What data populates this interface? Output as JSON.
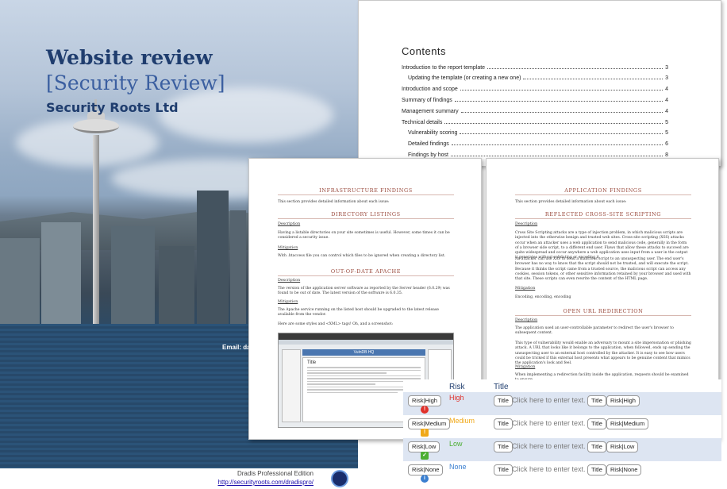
{
  "cover": {
    "title": "Website review",
    "subtitle": "[Security Review]",
    "company": "Security Roots Ltd",
    "email": "Email: dan",
    "edition": "Dradis Professional Edition",
    "url": "http://securityroots.com/dradispro/"
  },
  "contents": {
    "heading": "Contents",
    "entries": [
      {
        "label": "Introduction to the report template",
        "page": "3"
      },
      {
        "label": "Updating the template (or creating a new one)",
        "page": "3"
      },
      {
        "label": "Introduction and scope",
        "page": "4"
      },
      {
        "label": "Summary of findings",
        "page": "4"
      },
      {
        "label": "Management summary",
        "page": "4"
      },
      {
        "label": "Technical details",
        "page": "5"
      },
      {
        "label": "Vulnerability scoring",
        "page": "5"
      },
      {
        "label": "Detailed findings",
        "page": "6"
      },
      {
        "label": "Findings by host",
        "page": "8"
      }
    ]
  },
  "infra": {
    "heading": "INFRASTRUCTURE FINDINGS",
    "intro": "This section provides detailed information about each issue:",
    "f1_title": "DIRECTORY LISTINGS",
    "desc_label": "Description",
    "f1_desc": "Having a listable directories on your site sometimes is useful. However, some times it can be considered a security issue.",
    "mit_label": "Mitigation",
    "f1_mit": "With .htaccess file you can control which files to be ignored when creating a directory list.",
    "f2_title": "OUT-OF-DATE APACHE",
    "f2_desc": "The version of the application server software as reported by the Server header (6.0.29) was found to be out of date. The latest version of the software is 6.0.35.",
    "f2_mit": "The Apache service running on the listed host should be upgraded to the latest release available from the vendor.",
    "f2_note": "Here are some styles and <XML> tags! Oh, and a screenshot:",
    "shot_app": "VulnDB HQ",
    "shot_title": "Title"
  },
  "app": {
    "heading": "APPLICATION FINDINGS",
    "intro": "This section provides detailed information about each issue:",
    "f1_title": "REFLECTED CROSS-SITE SCRIPTING",
    "desc_label": "Description",
    "f1_desc": "Cross Site Scripting attacks are a type of injection problem, in which malicious scripts are injected into the otherwise benign and trusted web sites. Cross-site scripting (XSS) attacks occur when an attacker uses a web application to send malicious code, generally in the form of a browser side script, to a different end user. Flaws that allow these attacks to succeed are quite widespread and occur anywhere a web application uses input from a user in the output it generates without validating or encoding it.",
    "f1_desc2": "An attacker can use XSS to send a malicious script to an unsuspecting user. The end user's browser has no way to know that the script should not be trusted, and will execute the script. Because it thinks the script came from a trusted source, the malicious script can access any cookies, session tokens, or other sensitive information retained by your browser and used with that site. These scripts can even rewrite the content of the HTML page.",
    "mit_label": "Mitigation",
    "f1_mit": "Encoding, encoding, encoding",
    "f2_title": "OPEN URL REDIRECTION",
    "f2_desc": "The application used an user-controllable parameter to redirect the user's browser to subsequent content.",
    "f2_desc2": "This type of vulnerability would enable an adversary to mount a site impersonation or phishing attack. A URL that looks like it belongs to the application, when followed, ends up sending the unsuspecting user to an external host controlled by the attacker. It is easy to see how users could be tricked if this external host presents what appears to be genuine content that mimics the application's look and feel.",
    "f2_mit": "When implementing a redirection facility inside the application, requests should be examined to ensure"
  },
  "risk_table": {
    "col_risk": "Risk",
    "col_title": "Title",
    "rows": [
      {
        "tag": "Risk|High",
        "risk": "High",
        "color": "#e0302a",
        "icon": "!",
        "placeholder": "Click here to enter text.",
        "title_tag": "Title",
        "end_tag": "Risk|High"
      },
      {
        "tag": "Risk|Medium",
        "risk": "Medium",
        "color": "#f0a818",
        "icon": "!",
        "placeholder": "Click here to enter text.",
        "title_tag": "Title",
        "end_tag": "Risk|Medium"
      },
      {
        "tag": "Risk|Low",
        "risk": "Low",
        "color": "#4caf32",
        "icon": "✓",
        "placeholder": "Click here to enter text.",
        "title_tag": "Title",
        "end_tag": "Risk|Low"
      },
      {
        "tag": "Risk|None",
        "risk": "None",
        "color": "#3a7fd0",
        "icon": "i",
        "placeholder": "Click here to enter text.",
        "title_tag": "Title",
        "end_tag": "Risk|None"
      }
    ]
  }
}
